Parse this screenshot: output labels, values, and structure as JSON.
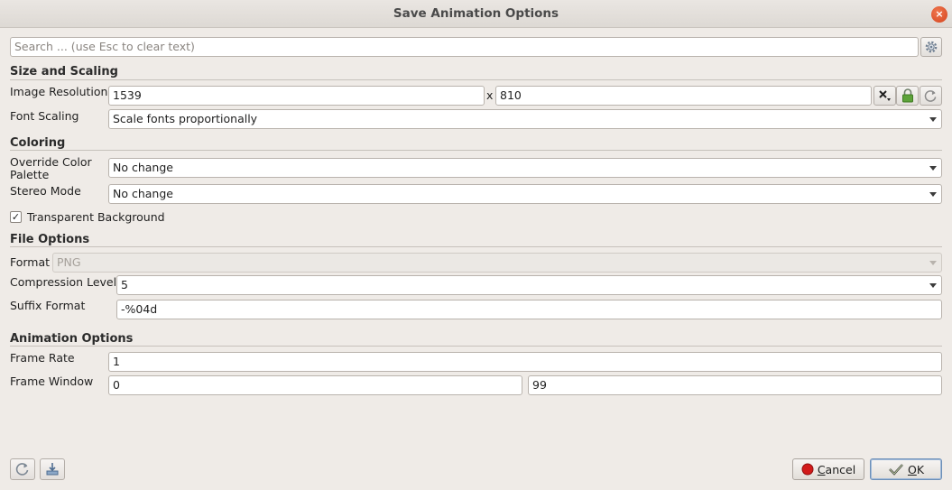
{
  "window": {
    "title": "Save Animation Options",
    "close_glyph": "×"
  },
  "search": {
    "placeholder": "Search ... (use Esc to clear text)",
    "value": ""
  },
  "sections": {
    "size": "Size and Scaling",
    "coloring": "Coloring",
    "file": "File Options",
    "animation": "Animation Options"
  },
  "size": {
    "resolution_label": "Image Resolution",
    "width": "1539",
    "x_sep": "x",
    "height": "810",
    "font_scaling_label": "Font Scaling",
    "font_scaling_value": "Scale fonts proportionally"
  },
  "coloring": {
    "palette_label_1": "Override Color",
    "palette_label_2": "Palette",
    "palette_value": "No change",
    "stereo_label": "Stereo Mode",
    "stereo_value": "No change",
    "transparent_label": "Transparent Background",
    "transparent_checked": true,
    "check_glyph": "✓"
  },
  "file": {
    "format_label": "Format",
    "format_value": "PNG",
    "compression_label": "Compression Level",
    "compression_value": "5",
    "suffix_label": "Suffix Format",
    "suffix_value": "-%04d"
  },
  "animation": {
    "frame_rate_label": "Frame Rate",
    "frame_rate_value": "1",
    "frame_window_label": "Frame Window",
    "frame_window_start": "0",
    "frame_window_end": "99"
  },
  "buttons": {
    "cancel_label_u": "C",
    "cancel_label_rest": "ancel",
    "ok_label_u": "O",
    "ok_label_rest": "K"
  },
  "icons": {
    "settings": "gear-icon",
    "x_menu": "close-menu-icon",
    "lock": "lock-icon",
    "reset": "reset-icon",
    "restore_defaults": "reset-icon",
    "save_defaults": "save-icon",
    "cancel": "stop-icon",
    "ok": "checkmark-icon"
  },
  "colors": {
    "accent": "#6c8fb8",
    "cancel_red": "#d21a1a",
    "lock_green": "#4f9a2e"
  }
}
